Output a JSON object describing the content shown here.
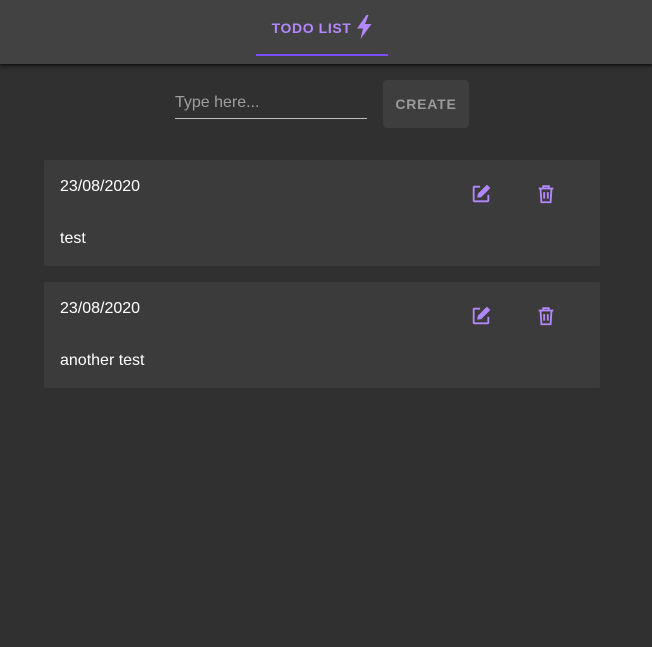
{
  "header": {
    "tab_label": "TODO LIST",
    "tab_icon": "lightning-bolt-icon",
    "accent_color": "#b388ff",
    "indicator_color": "#7c4dff"
  },
  "form": {
    "input_placeholder": "Type here...",
    "input_value": "",
    "create_label": "CREATE"
  },
  "todos": [
    {
      "date": "23/08/2020",
      "text": "test",
      "edit_icon": "edit-icon",
      "delete_icon": "trash-icon"
    },
    {
      "date": "23/08/2020",
      "text": "another test",
      "edit_icon": "edit-icon",
      "delete_icon": "trash-icon"
    }
  ]
}
